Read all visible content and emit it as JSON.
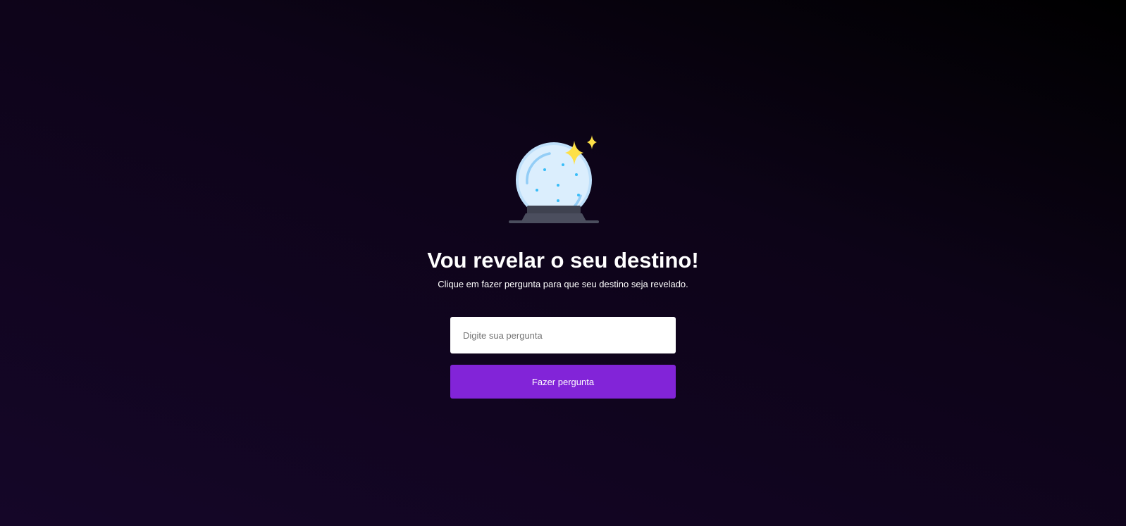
{
  "hero": {
    "icon": "crystal-ball-icon",
    "title": "Vou revelar o seu destino!",
    "subtitle": "Clique em fazer pergunta para que seu destino seja revelado."
  },
  "form": {
    "question_placeholder": "Digite sua pergunta",
    "question_value": "",
    "submit_label": "Fazer pergunta"
  },
  "colors": {
    "accent": "#8224d8",
    "background_dark": "#000000",
    "background_purple": "#150628",
    "sparkle": "#fde047",
    "globe": "#dbeefd",
    "globe_dots": "#38bdf8",
    "base": "#3f4250"
  }
}
